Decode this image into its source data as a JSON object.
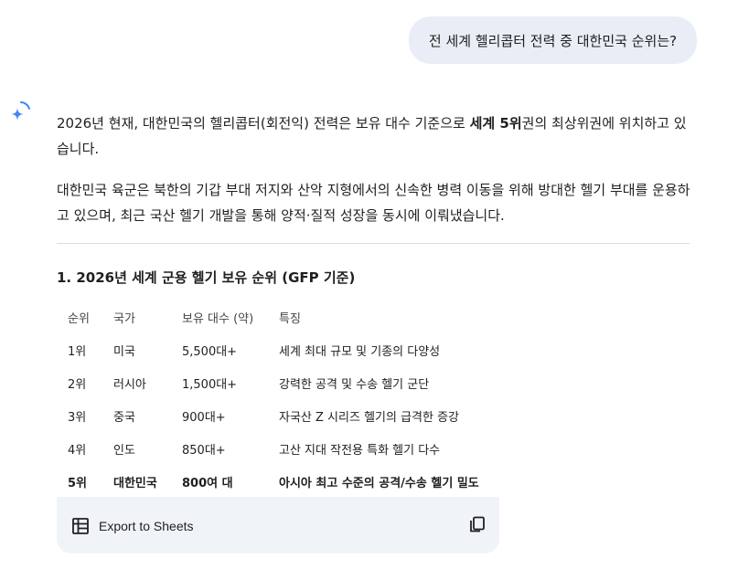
{
  "user_message": "전 세계 헬리콥터 전력 중 대한민국 순위는?",
  "response": {
    "p1_a": "2026년 현재, 대한민국의 헬리콥터(회전익) 전력은 보유 대수 기준으로 ",
    "p1_bold": "세계 5위",
    "p1_b": "권의 최상위권에 위치하고 있습니다.",
    "p2": "대한민국 육군은 북한의 기갑 부대 저지와 산악 지형에서의 신속한 병력 이동을 위해 방대한 헬기 부대를 운용하고 있으며, 최근 국산 헬기 개발을 통해 양적·질적 성장을 동시에 이뤄냈습니다.",
    "section_title": "1. 2026년 세계 군용 헬기 보유 순위 (GFP 기준)"
  },
  "table": {
    "headers": [
      "순위",
      "국가",
      "보유 대수 (약)",
      "특징"
    ],
    "rows": [
      [
        "1위",
        "미국",
        "5,500대+",
        "세계 최대 규모 및 기종의 다양성"
      ],
      [
        "2위",
        "러시아",
        "1,500대+",
        "강력한 공격 및 수송 헬기 군단"
      ],
      [
        "3위",
        "중국",
        "900대+",
        "자국산 Z 시리즈 헬기의 급격한 증강"
      ],
      [
        "4위",
        "인도",
        "850대+",
        "고산 지대 작전용 특화 헬기 다수"
      ],
      [
        "5위",
        "대한민국",
        "800여 대",
        "아시아 최고 수준의 공격/수송 헬기 밀도"
      ]
    ]
  },
  "footer": {
    "export_label": "Export to Sheets"
  },
  "icons": {
    "spark": "gemini-spark-icon",
    "sheets": "table-icon",
    "copy": "copy-icon"
  },
  "colors": {
    "bubble": "#e9eef6",
    "accent_blue": "#4285f4",
    "card_bg": "#f0f4f9"
  }
}
